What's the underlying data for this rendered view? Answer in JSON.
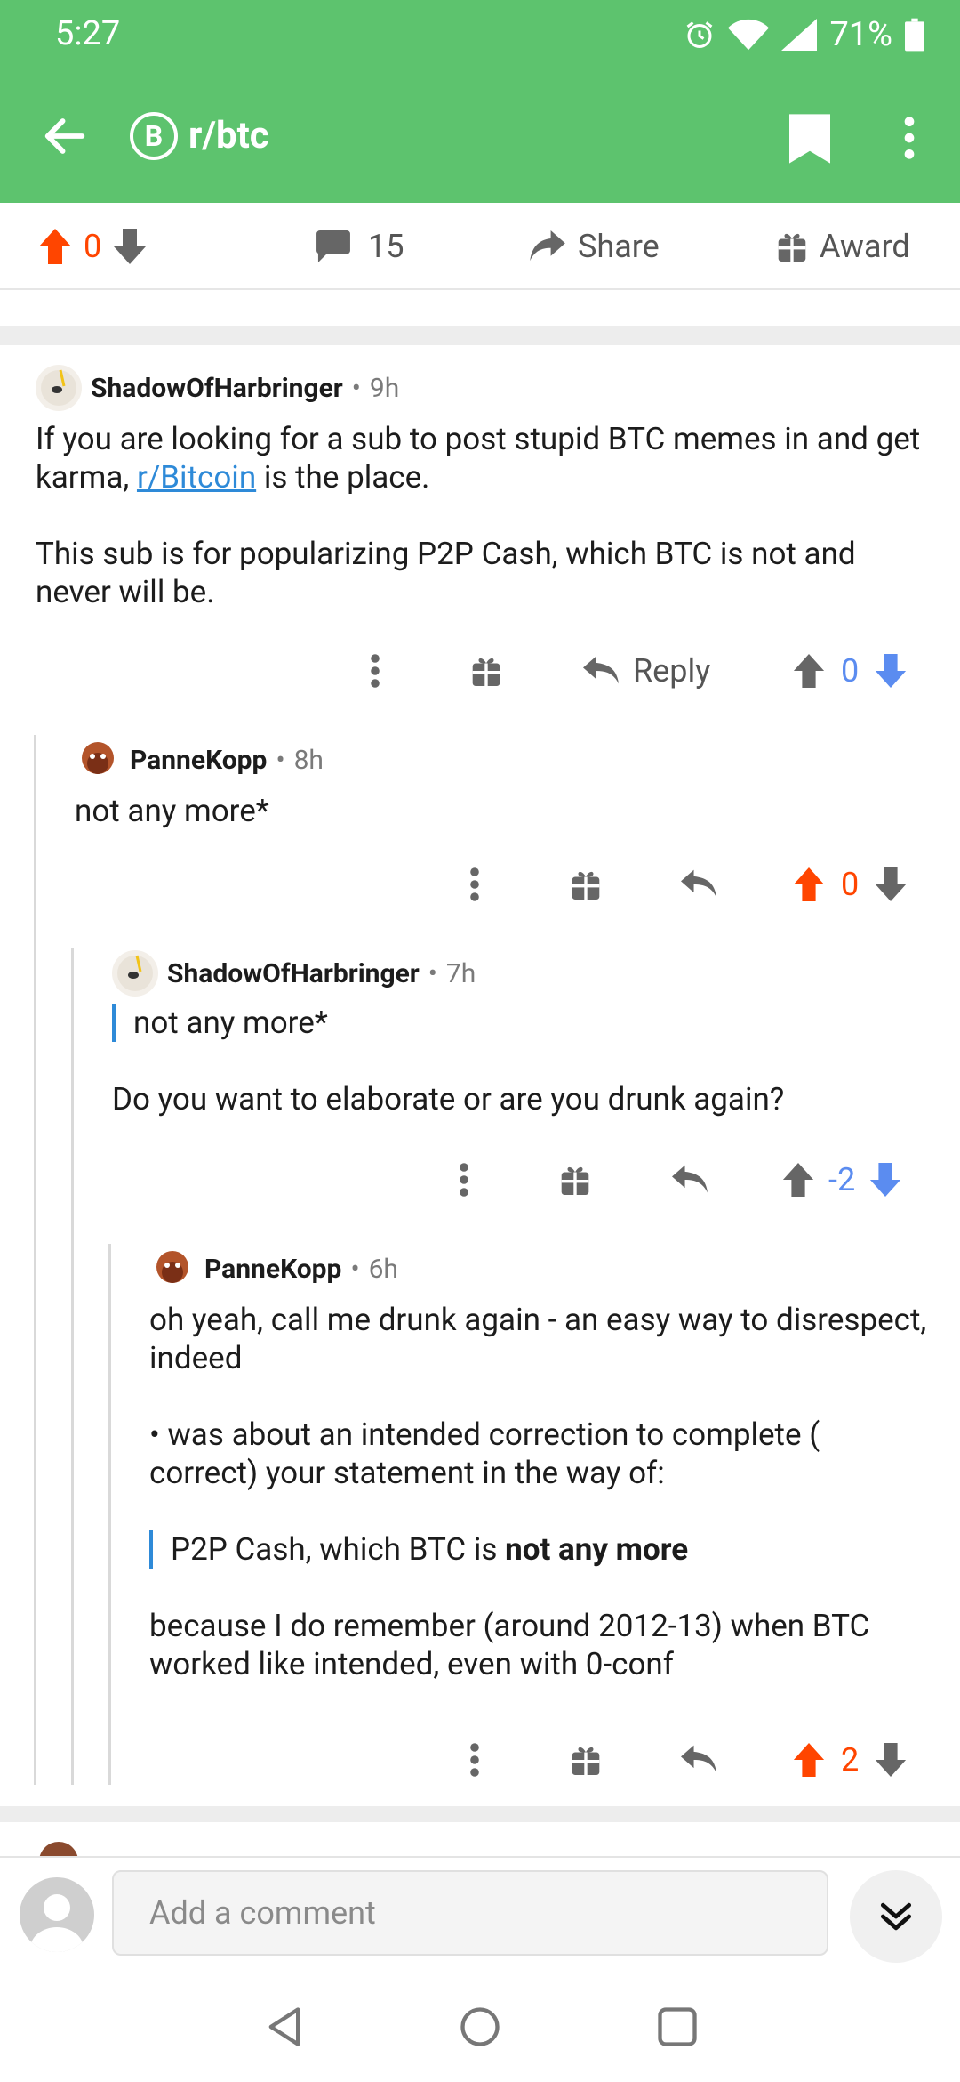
{
  "status": {
    "time": "5:27",
    "battery": "71%"
  },
  "appbar": {
    "subreddit": "r/btc",
    "sub_logo": "B"
  },
  "post_actions": {
    "score": "0",
    "comments": "15",
    "share": "Share",
    "award": "Award"
  },
  "comments": [
    {
      "author": "ShadowOfHarbringer",
      "time": "9h",
      "p1_a": "If you are looking for a sub to post stupid BTC memes in and get karma, ",
      "p1_link": "r/Bitcoin",
      "p1_b": " is the place.",
      "p2": "This sub is for popularizing P2P Cash, which BTC is not and never will be.",
      "reply": "Reply",
      "score": "0"
    },
    {
      "author": "PanneKopp",
      "time": "8h",
      "text": "not any more*",
      "score": "0"
    },
    {
      "author": "ShadowOfHarbringer",
      "time": "7h",
      "quote": "not any more*",
      "text": "Do you want to elaborate or are you drunk again?",
      "score": "-2"
    },
    {
      "author": "PanneKopp",
      "time": "6h",
      "p1": "oh yeah, call me drunk again - an easy way to disrespect, indeed",
      "p2": "• was about an intended correction to complete ( correct) your statement in the way of:",
      "quote_a": "P2P Cash, which BTC is ",
      "quote_b": "not any more",
      "p3": "because I do remember (around 2012-13) when BTC worked like intended, even with 0-conf",
      "score": "2"
    }
  ],
  "comment_bar": {
    "placeholder": "Add a comment"
  },
  "colors": {
    "accent": "#5dc36e",
    "upvote": "#ff4500",
    "downvote": "#5b8cf0",
    "link": "#2e8ad8"
  }
}
